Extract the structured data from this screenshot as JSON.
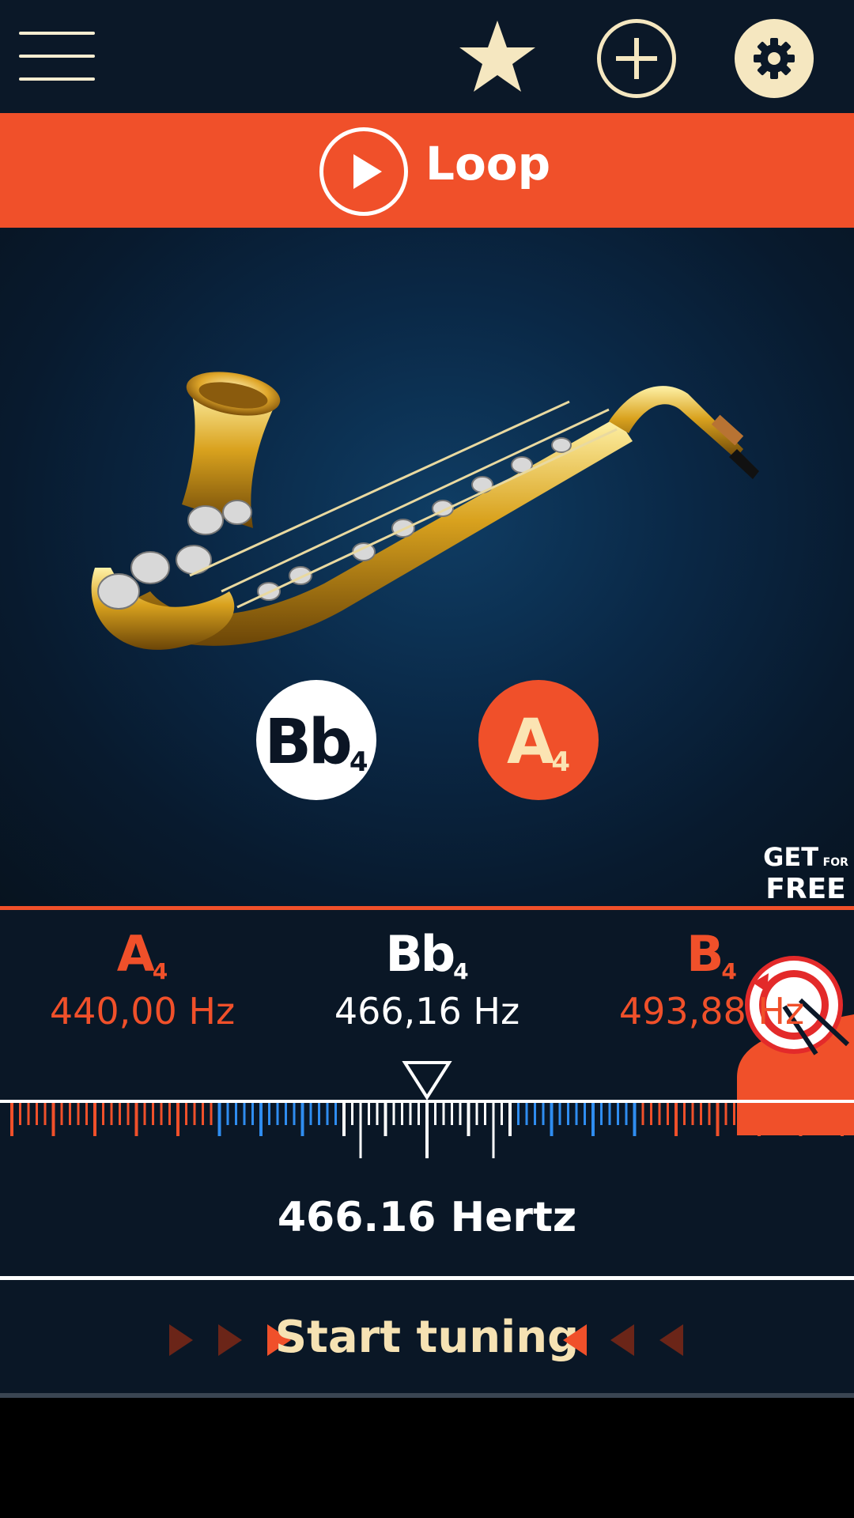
{
  "topbar": {
    "menu_icon": "hamburger-menu-icon",
    "favorite_icon": "star-icon",
    "add_icon": "plus-icon",
    "settings_icon": "gear-icon",
    "icon_color": "#f5e7c0"
  },
  "loop": {
    "label": "Loop",
    "icon": "play-icon",
    "background": "#f0502a"
  },
  "instrument": {
    "image": "saxophone"
  },
  "note_buttons": [
    {
      "note": "Bb",
      "octave": "4",
      "selected": true
    },
    {
      "note": "A",
      "octave": "4",
      "selected": false
    }
  ],
  "promo": {
    "get": "GET",
    "for": "FOR",
    "free": "FREE",
    "icon": "drum-loop-app-icon"
  },
  "frequencies": {
    "left": {
      "note": "A",
      "octave": "4",
      "hz": "440,00 Hz"
    },
    "center": {
      "note": "Bb",
      "octave": "4",
      "hz": "466,16 Hz"
    },
    "right": {
      "note": "B",
      "octave": "4",
      "hz": "493,88 Hz"
    }
  },
  "meter": {
    "current_hertz": "466.16 Hertz",
    "pointer_icon": "triangle-pointer-icon",
    "colors": {
      "orange": "#f0502a",
      "blue": "#2f8df0",
      "white": "#ffffff"
    }
  },
  "tuning": {
    "label": "Start tuning",
    "arrow_icon_left": "arrow-right-icon",
    "arrow_icon_right": "arrow-left-icon"
  }
}
